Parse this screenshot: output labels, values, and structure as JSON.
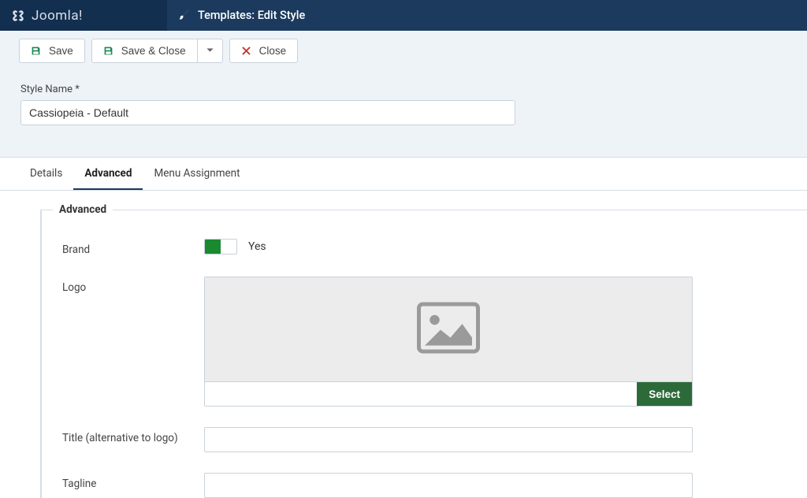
{
  "header": {
    "brand": "Joomla!",
    "page_title": "Templates: Edit Style"
  },
  "toolbar": {
    "save": "Save",
    "save_close": "Save & Close",
    "close": "Close"
  },
  "form": {
    "style_name_label": "Style Name *",
    "style_name_value": "Cassiopeia - Default"
  },
  "tabs": {
    "details": "Details",
    "advanced": "Advanced",
    "menu_assignment": "Menu Assignment",
    "active": "advanced"
  },
  "advanced": {
    "legend": "Advanced",
    "brand": {
      "label": "Brand",
      "state_label": "Yes"
    },
    "logo": {
      "label": "Logo",
      "select_button": "Select",
      "value": ""
    },
    "title": {
      "label": "Title (alternative to logo)",
      "value": ""
    },
    "tagline": {
      "label": "Tagline",
      "value": ""
    }
  }
}
